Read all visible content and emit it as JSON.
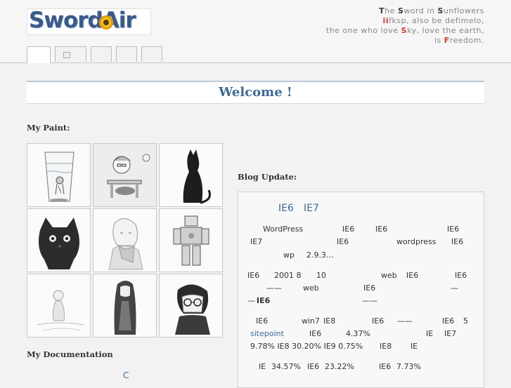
{
  "header": {
    "logo_text": "SwordAir",
    "tagline": {
      "line1": [
        "T",
        "he ",
        "S",
        "word in ",
        "S",
        "unflowers"
      ],
      "line2": [
        "ii",
        "fksp, also be defimelo,"
      ],
      "line3": [
        "the one who love ",
        "S",
        "ky, love the earth,"
      ],
      "line4": [
        "is ",
        "F",
        "reedom."
      ]
    },
    "tabs": [
      "",
      "",
      "",
      "",
      ""
    ]
  },
  "welcome": {
    "title": "Welcome !"
  },
  "sections": {
    "paint": "My Paint:",
    "blog": "Blog Update:",
    "docs": "My Documentation"
  },
  "gallery": {
    "items": [
      "glass-of-water",
      "child-at-desk",
      "black-cat",
      "grey-kitten",
      "girl-with-scarf",
      "robot-figure",
      "seated-figure",
      "long-haired-girl",
      "boy-with-glasses"
    ]
  },
  "blog": {
    "title_a": "IE6",
    "title_b": "IE7",
    "p1_a": "WordPress",
    "p1_b": "IE6",
    "p1_c": "IE6",
    "p1_d": "IE6",
    "p1_e": "IE7",
    "p1_f": "IE6",
    "p1_g": "wordpress",
    "p1_h": "IE6",
    "p1_i": "wp",
    "p1_j": "2.9.3…",
    "p2_a": "IE6",
    "p2_b": "2001 8",
    "p2_c": "10",
    "p2_d": "web",
    "p2_e": "IE6",
    "p2_f": "IE6",
    "p2_g": "——",
    "p2_h": "web",
    "p2_i": "IE6",
    "p2_j": "—",
    "p2_k": "—",
    "p2_l": "IE6",
    "p2_m": "——",
    "p3_a": "IE6",
    "p3_b": "win7",
    "p3_c": "IE8",
    "p3_d": "IE6",
    "p3_e": "——",
    "p3_f": "IE6",
    "p3_g": "5",
    "p3_link": "sitepoint",
    "p3_h": "IE6",
    "p3_i": "4.37%",
    "p3_j": "IE",
    "p3_k": "IE7",
    "p3_l": "9.78% IE8 30.20% IE9 0.75%",
    "p3_m": "IE8",
    "p3_n": "IE",
    "p4_a": "IE",
    "p4_b": "34.57%",
    "p4_c": "IE6",
    "p4_d": "23.22%",
    "p4_e": "IE6",
    "p4_f": "7.73%"
  },
  "docs": {
    "link_text": "C"
  },
  "colors": {
    "accent": "#3e6a97",
    "highlight_red": "#d63a2a",
    "background": "#f2f2f2"
  }
}
